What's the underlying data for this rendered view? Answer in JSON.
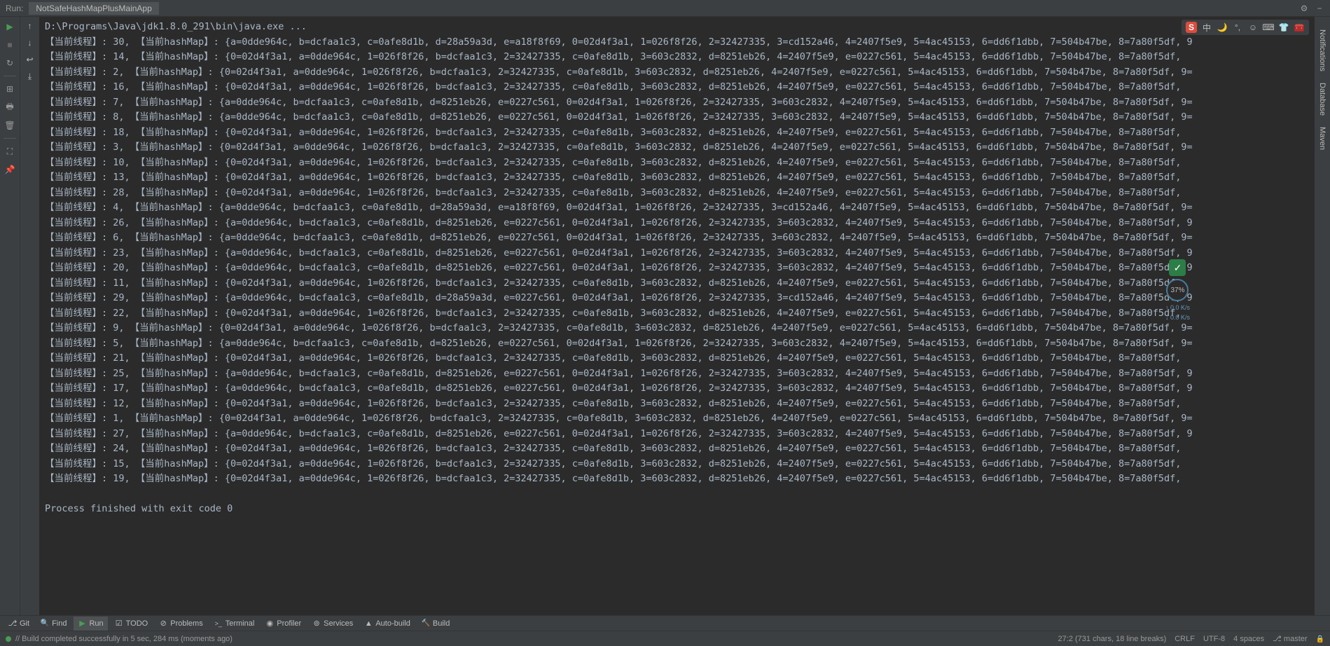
{
  "titlebar": {
    "run_label": "Run:",
    "tab_name": "NotSafeHashMapPlusMainApp"
  },
  "console": {
    "cmd": "D:\\Programs\\Java\\jdk1.8.0_291\\bin\\java.exe ...",
    "lines": [
      "【当前线程】: 30, 【当前hashMap】: {a=0dde964c, b=dcfaa1c3, c=0afe8d1b, d=28a59a3d, e=a18f8f69, 0=02d4f3a1, 1=026f8f26, 2=32427335, 3=cd152a46, 4=2407f5e9, 5=4ac45153, 6=dd6f1dbb, 7=504b47be, 8=7a80f5df, 9",
      "【当前线程】: 14, 【当前hashMap】: {0=02d4f3a1, a=0dde964c, 1=026f8f26, b=dcfaa1c3, 2=32427335, c=0afe8d1b, 3=603c2832, d=8251eb26, 4=2407f5e9, e=0227c561, 5=4ac45153, 6=dd6f1dbb, 7=504b47be, 8=7a80f5df,",
      "【当前线程】: 2, 【当前hashMap】: {0=02d4f3a1, a=0dde964c, 1=026f8f26, b=dcfaa1c3, 2=32427335, c=0afe8d1b, 3=603c2832, d=8251eb26, 4=2407f5e9, e=0227c561, 5=4ac45153, 6=dd6f1dbb, 7=504b47be, 8=7a80f5df, 9=",
      "【当前线程】: 16, 【当前hashMap】: {0=02d4f3a1, a=0dde964c, 1=026f8f26, b=dcfaa1c3, 2=32427335, c=0afe8d1b, 3=603c2832, d=8251eb26, 4=2407f5e9, e=0227c561, 5=4ac45153, 6=dd6f1dbb, 7=504b47be, 8=7a80f5df,",
      "【当前线程】: 7, 【当前hashMap】: {a=0dde964c, b=dcfaa1c3, c=0afe8d1b, d=8251eb26, e=0227c561, 0=02d4f3a1, 1=026f8f26, 2=32427335, 3=603c2832, 4=2407f5e9, 5=4ac45153, 6=dd6f1dbb, 7=504b47be, 8=7a80f5df, 9=",
      "【当前线程】: 8, 【当前hashMap】: {a=0dde964c, b=dcfaa1c3, c=0afe8d1b, d=8251eb26, e=0227c561, 0=02d4f3a1, 1=026f8f26, 2=32427335, 3=603c2832, 4=2407f5e9, 5=4ac45153, 6=dd6f1dbb, 7=504b47be, 8=7a80f5df, 9=",
      "【当前线程】: 18, 【当前hashMap】: {0=02d4f3a1, a=0dde964c, 1=026f8f26, b=dcfaa1c3, 2=32427335, c=0afe8d1b, 3=603c2832, d=8251eb26, 4=2407f5e9, e=0227c561, 5=4ac45153, 6=dd6f1dbb, 7=504b47be, 8=7a80f5df,",
      "【当前线程】: 3, 【当前hashMap】: {0=02d4f3a1, a=0dde964c, 1=026f8f26, b=dcfaa1c3, 2=32427335, c=0afe8d1b, 3=603c2832, d=8251eb26, 4=2407f5e9, e=0227c561, 5=4ac45153, 6=dd6f1dbb, 7=504b47be, 8=7a80f5df, 9=",
      "【当前线程】: 10, 【当前hashMap】: {0=02d4f3a1, a=0dde964c, 1=026f8f26, b=dcfaa1c3, 2=32427335, c=0afe8d1b, 3=603c2832, d=8251eb26, 4=2407f5e9, e=0227c561, 5=4ac45153, 6=dd6f1dbb, 7=504b47be, 8=7a80f5df,",
      "【当前线程】: 13, 【当前hashMap】: {0=02d4f3a1, a=0dde964c, 1=026f8f26, b=dcfaa1c3, 2=32427335, c=0afe8d1b, 3=603c2832, d=8251eb26, 4=2407f5e9, e=0227c561, 5=4ac45153, 6=dd6f1dbb, 7=504b47be, 8=7a80f5df,",
      "【当前线程】: 28, 【当前hashMap】: {0=02d4f3a1, a=0dde964c, 1=026f8f26, b=dcfaa1c3, 2=32427335, c=0afe8d1b, 3=603c2832, d=8251eb26, 4=2407f5e9, e=0227c561, 5=4ac45153, 6=dd6f1dbb, 7=504b47be, 8=7a80f5df,",
      "【当前线程】: 4, 【当前hashMap】: {a=0dde964c, b=dcfaa1c3, c=0afe8d1b, d=28a59a3d, e=a18f8f69, 0=02d4f3a1, 1=026f8f26, 2=32427335, 3=cd152a46, 4=2407f5e9, 5=4ac45153, 6=dd6f1dbb, 7=504b47be, 8=7a80f5df, 9=",
      "【当前线程】: 26, 【当前hashMap】: {a=0dde964c, b=dcfaa1c3, c=0afe8d1b, d=8251eb26, e=0227c561, 0=02d4f3a1, 1=026f8f26, 2=32427335, 3=603c2832, 4=2407f5e9, 5=4ac45153, 6=dd6f1dbb, 7=504b47be, 8=7a80f5df, 9",
      "【当前线程】: 6, 【当前hashMap】: {a=0dde964c, b=dcfaa1c3, c=0afe8d1b, d=8251eb26, e=0227c561, 0=02d4f3a1, 1=026f8f26, 2=32427335, 3=603c2832, 4=2407f5e9, 5=4ac45153, 6=dd6f1dbb, 7=504b47be, 8=7a80f5df, 9=",
      "【当前线程】: 23, 【当前hashMap】: {a=0dde964c, b=dcfaa1c3, c=0afe8d1b, d=8251eb26, e=0227c561, 0=02d4f3a1, 1=026f8f26, 2=32427335, 3=603c2832, 4=2407f5e9, 5=4ac45153, 6=dd6f1dbb, 7=504b47be, 8=7a80f5df, 9",
      "【当前线程】: 20, 【当前hashMap】: {a=0dde964c, b=dcfaa1c3, c=0afe8d1b, d=8251eb26, e=0227c561, 0=02d4f3a1, 1=026f8f26, 2=32427335, 3=603c2832, 4=2407f5e9, 5=4ac45153, 6=dd6f1dbb, 7=504b47be, 8=7a80f5df, 9",
      "【当前线程】: 11, 【当前hashMap】: {0=02d4f3a1, a=0dde964c, 1=026f8f26, b=dcfaa1c3, 2=32427335, c=0afe8d1b, 3=603c2832, d=8251eb26, 4=2407f5e9, e=0227c561, 5=4ac45153, 6=dd6f1dbb, 7=504b47be, 8=7a80f5df,",
      "【当前线程】: 29, 【当前hashMap】: {a=0dde964c, b=dcfaa1c3, c=0afe8d1b, d=28a59a3d, e=0227c561, 0=02d4f3a1, 1=026f8f26, 2=32427335, 3=cd152a46, 4=2407f5e9, 5=4ac45153, 6=dd6f1dbb, 7=504b47be, 8=7a80f5df, 9",
      "【当前线程】: 22, 【当前hashMap】: {0=02d4f3a1, a=0dde964c, 1=026f8f26, b=dcfaa1c3, 2=32427335, c=0afe8d1b, 3=603c2832, d=8251eb26, 4=2407f5e9, e=0227c561, 5=4ac45153, 6=dd6f1dbb, 7=504b47be, 8=7a80f5df,",
      "【当前线程】: 9, 【当前hashMap】: {0=02d4f3a1, a=0dde964c, 1=026f8f26, b=dcfaa1c3, 2=32427335, c=0afe8d1b, 3=603c2832, d=8251eb26, 4=2407f5e9, e=0227c561, 5=4ac45153, 6=dd6f1dbb, 7=504b47be, 8=7a80f5df, 9=",
      "【当前线程】: 5, 【当前hashMap】: {a=0dde964c, b=dcfaa1c3, c=0afe8d1b, d=8251eb26, e=0227c561, 0=02d4f3a1, 1=026f8f26, 2=32427335, 3=603c2832, 4=2407f5e9, 5=4ac45153, 6=dd6f1dbb, 7=504b47be, 8=7a80f5df, 9=",
      "【当前线程】: 21, 【当前hashMap】: {0=02d4f3a1, a=0dde964c, 1=026f8f26, b=dcfaa1c3, 2=32427335, c=0afe8d1b, 3=603c2832, d=8251eb26, 4=2407f5e9, e=0227c561, 5=4ac45153, 6=dd6f1dbb, 7=504b47be, 8=7a80f5df,",
      "【当前线程】: 25, 【当前hashMap】: {a=0dde964c, b=dcfaa1c3, c=0afe8d1b, d=8251eb26, e=0227c561, 0=02d4f3a1, 1=026f8f26, 2=32427335, 3=603c2832, 4=2407f5e9, 5=4ac45153, 6=dd6f1dbb, 7=504b47be, 8=7a80f5df, 9",
      "【当前线程】: 17, 【当前hashMap】: {a=0dde964c, b=dcfaa1c3, c=0afe8d1b, d=8251eb26, e=0227c561, 0=02d4f3a1, 1=026f8f26, 2=32427335, 3=603c2832, 4=2407f5e9, 5=4ac45153, 6=dd6f1dbb, 7=504b47be, 8=7a80f5df, 9",
      "【当前线程】: 12, 【当前hashMap】: {0=02d4f3a1, a=0dde964c, 1=026f8f26, b=dcfaa1c3, 2=32427335, c=0afe8d1b, 3=603c2832, d=8251eb26, 4=2407f5e9, e=0227c561, 5=4ac45153, 6=dd6f1dbb, 7=504b47be, 8=7a80f5df,",
      "【当前线程】: 1, 【当前hashMap】: {0=02d4f3a1, a=0dde964c, 1=026f8f26, b=dcfaa1c3, 2=32427335, c=0afe8d1b, 3=603c2832, d=8251eb26, 4=2407f5e9, e=0227c561, 5=4ac45153, 6=dd6f1dbb, 7=504b47be, 8=7a80f5df, 9=",
      "【当前线程】: 27, 【当前hashMap】: {a=0dde964c, b=dcfaa1c3, c=0afe8d1b, d=8251eb26, e=0227c561, 0=02d4f3a1, 1=026f8f26, 2=32427335, 3=603c2832, 4=2407f5e9, 5=4ac45153, 6=dd6f1dbb, 7=504b47be, 8=7a80f5df, 9",
      "【当前线程】: 24, 【当前hashMap】: {0=02d4f3a1, a=0dde964c, 1=026f8f26, b=dcfaa1c3, 2=32427335, c=0afe8d1b, 3=603c2832, d=8251eb26, 4=2407f5e9, e=0227c561, 5=4ac45153, 6=dd6f1dbb, 7=504b47be, 8=7a80f5df,",
      "【当前线程】: 15, 【当前hashMap】: {0=02d4f3a1, a=0dde964c, 1=026f8f26, b=dcfaa1c3, 2=32427335, c=0afe8d1b, 3=603c2832, d=8251eb26, 4=2407f5e9, e=0227c561, 5=4ac45153, 6=dd6f1dbb, 7=504b47be, 8=7a80f5df,",
      "【当前线程】: 19, 【当前hashMap】: {0=02d4f3a1, a=0dde964c, 1=026f8f26, b=dcfaa1c3, 2=32427335, c=0afe8d1b, 3=603c2832, d=8251eb26, 4=2407f5e9, e=0227c561, 5=4ac45153, 6=dd6f1dbb, 7=504b47be, 8=7a80f5df,"
    ],
    "exit": "Process finished with exit code 0"
  },
  "toolbar": {
    "git": "Git",
    "find": "Find",
    "run": "Run",
    "todo": "TODO",
    "problems": "Problems",
    "terminal": "Terminal",
    "profiler": "Profiler",
    "services": "Services",
    "autobuild": "Auto-build",
    "build": "Build"
  },
  "statusbar": {
    "msg": "// Build completed successfully in 5 sec, 284 ms (moments ago)",
    "pos": "27:2 (731 chars, 18 line breaks)",
    "eol": "CRLF",
    "enc": "UTF-8",
    "indent": "4 spaces",
    "branch": "master"
  },
  "right_tabs": {
    "notifications": "Notifications",
    "database": "Database",
    "maven": "Maven"
  },
  "widget": {
    "percent": "37%",
    "up": "↑ 0.0\nK/s",
    "down": "↓ 0.0\nK/s"
  },
  "ime": {
    "sogou": "S",
    "lang": "中"
  }
}
